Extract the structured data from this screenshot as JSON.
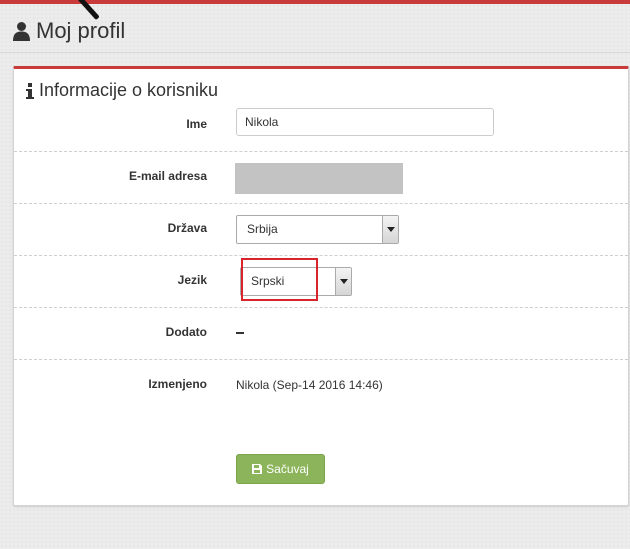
{
  "page": {
    "title": "Moj profil",
    "title_icon": "user-icon"
  },
  "panel": {
    "title": "Informacije o korisniku",
    "title_icon": "info-icon",
    "accent_color": "#c93b3b"
  },
  "fields": {
    "name": {
      "label": "Ime",
      "value": "Nikola"
    },
    "email": {
      "label": "E-mail adresa",
      "value_hidden": true
    },
    "country": {
      "label": "Država",
      "selected": "Srbija"
    },
    "language": {
      "label": "Jezik",
      "selected": "Srpski",
      "highlight_color": "#d9242c"
    },
    "added": {
      "label": "Dodato",
      "value": "–"
    },
    "modified": {
      "label": "Izmenjeno",
      "value": "Nikola (Sep-14 2016 14:46)"
    }
  },
  "actions": {
    "save": {
      "label": "Sačuvaj",
      "icon": "floppy-disk-icon",
      "color": "#8cb45a"
    }
  }
}
